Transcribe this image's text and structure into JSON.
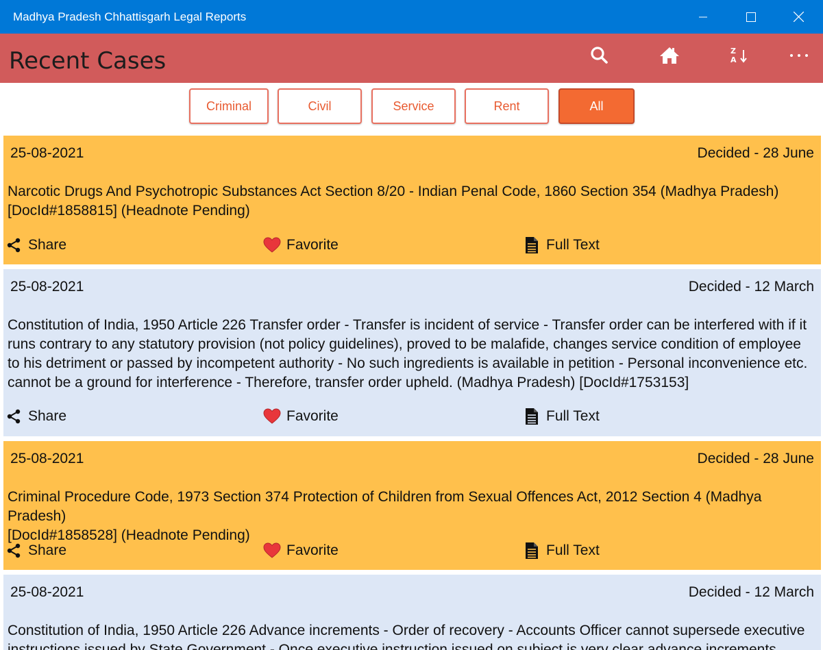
{
  "window": {
    "title": "Madhya Pradesh Chhattisgarh Legal Reports"
  },
  "header": {
    "title": "Recent Cases",
    "icons": [
      "search-icon",
      "home-icon",
      "sort-az-icon",
      "more-icon"
    ]
  },
  "filters": {
    "items": [
      {
        "label": "Criminal"
      },
      {
        "label": "Civil"
      },
      {
        "label": "Service"
      },
      {
        "label": "Rent"
      },
      {
        "label": "All"
      }
    ],
    "selected": "All"
  },
  "colors": {
    "titlebar": "#0078d7",
    "header": "#d15b5b",
    "accent": "#f36a32",
    "card_orange": "#ffc04c",
    "card_blue": "#dde7f6"
  },
  "actions": {
    "share": "Share",
    "favorite": "Favorite",
    "full_text": "Full Text"
  },
  "cases": [
    {
      "date": "25-08-2021",
      "decided": "Decided - 28 June",
      "lines": [
        "Narcotic Drugs And Psychotropic Substances Act Section 8/20 - Indian Penal Code, 1860 Section 354 (Madhya Pradesh)",
        "[DocId#1858815] (Headnote Pending)"
      ]
    },
    {
      "date": "25-08-2021",
      "decided": "Decided - 12 March",
      "lines": [
        "Constitution of India, 1950 Article 226 Transfer order - Transfer is incident of service - Transfer order can be interfered with if it",
        "runs contrary to any statutory provision (not policy guidelines), proved to be malafide, changes service condition of employee",
        "to his detriment or passed by incompetent authority - No such ingredients is available in petition - Personal inconvenience etc.",
        "cannot be a ground for interference - Therefore, transfer order upheld. (Madhya Pradesh) [DocId#1753153]"
      ]
    },
    {
      "date": "25-08-2021",
      "decided": "Decided - 28 June",
      "lines": [
        "Criminal Procedure Code, 1973 Section 374 Protection of Children from Sexual Offences Act, 2012 Section 4 (Madhya Pradesh)",
        "[DocId#1858528] (Headnote Pending)"
      ]
    },
    {
      "date": "25-08-2021",
      "decided": "Decided - 12 March",
      "lines": [
        "Constitution of India, 1950 Article 226 Advance increments - Order of recovery - Accounts Officer cannot supersede executive",
        "instructions issued by State Government - Once executive instruction issued on subject is very clear advance increments rightly"
      ]
    }
  ]
}
